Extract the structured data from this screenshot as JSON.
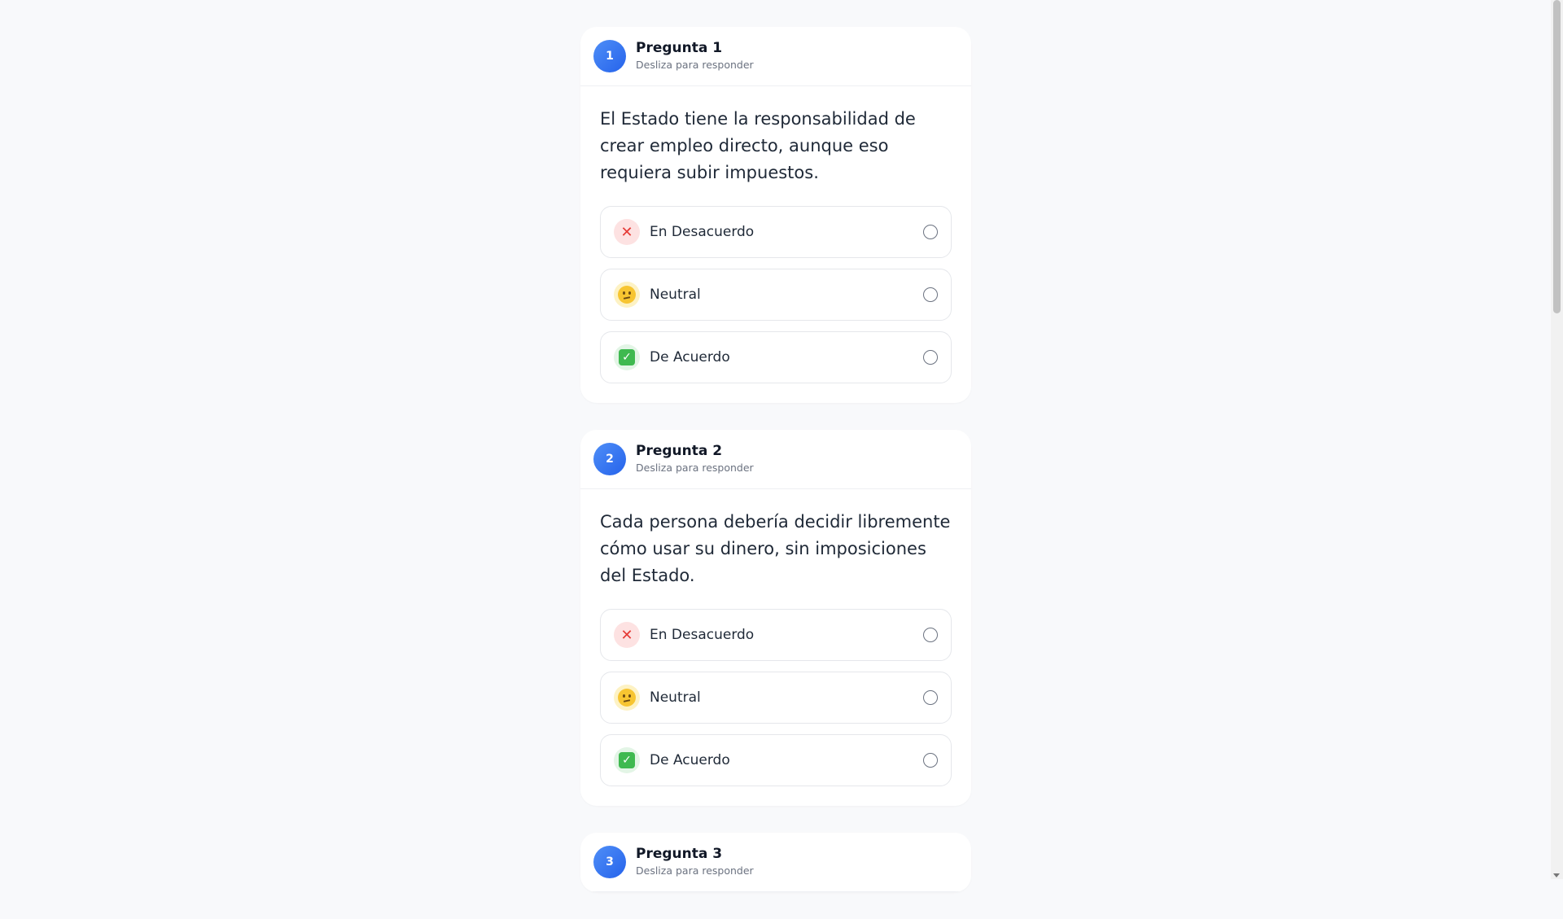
{
  "colors": {
    "badge": "#2563eb",
    "background": "#f8f9fb",
    "disagree": "#e53935",
    "agree": "#3fb950"
  },
  "questions": [
    {
      "number": "1",
      "title": "Pregunta 1",
      "subtitle": "Desliza para responder",
      "statement": "El Estado tiene la responsabilidad de crear empleo directo, aunque eso requiera subir impuestos.",
      "options": [
        {
          "label": "En Desacuerdo",
          "icon": "cross-mark-icon",
          "selected": false
        },
        {
          "label": "Neutral",
          "icon": "thinking-face-icon",
          "selected": false
        },
        {
          "label": "De Acuerdo",
          "icon": "check-mark-icon",
          "selected": false
        }
      ]
    },
    {
      "number": "2",
      "title": "Pregunta 2",
      "subtitle": "Desliza para responder",
      "statement": "Cada persona debería decidir libremente cómo usar su dinero, sin imposiciones del Estado.",
      "options": [
        {
          "label": "En Desacuerdo",
          "icon": "cross-mark-icon",
          "selected": false
        },
        {
          "label": "Neutral",
          "icon": "thinking-face-icon",
          "selected": false
        },
        {
          "label": "De Acuerdo",
          "icon": "check-mark-icon",
          "selected": false
        }
      ]
    },
    {
      "number": "3",
      "title": "Pregunta 3",
      "subtitle": "Desliza para responder"
    }
  ]
}
